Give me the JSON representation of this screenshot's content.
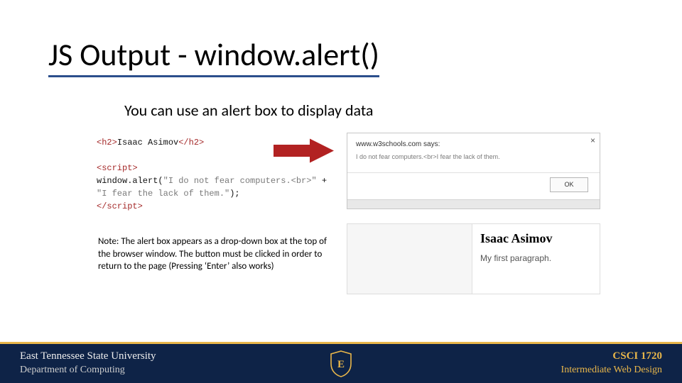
{
  "title": "JS Output - window.alert()",
  "subtitle": "You can use an alert box to display data",
  "code": {
    "l1a": "<h2>",
    "l1b": "Isaac Asimov",
    "l1c": "</h2>",
    "l2": "<script>",
    "l3a": "window.alert(",
    "l3b": "\"I do not fear computers.<br>\"",
    "l3c": " +",
    "l4a": "\"I fear the lack of them.\"",
    "l4b": ");",
    "l5": "</script>"
  },
  "alert": {
    "origin": "www.w3schools.com says:",
    "message": "I do not fear computers.<br>I fear the lack of them.",
    "ok": "OK"
  },
  "output": {
    "heading": "Isaac Asimov",
    "para": "My first paragraph."
  },
  "note": "Note: The alert box appears as a drop-down box at the top of the browser window. The button must be clicked in order to return to the page (Pressing ‘Enter’ also works)",
  "footer": {
    "left1": "East Tennessee State University",
    "left2": "Department of Computing",
    "right1": "CSCI 1720",
    "right2": "Intermediate Web Design"
  }
}
